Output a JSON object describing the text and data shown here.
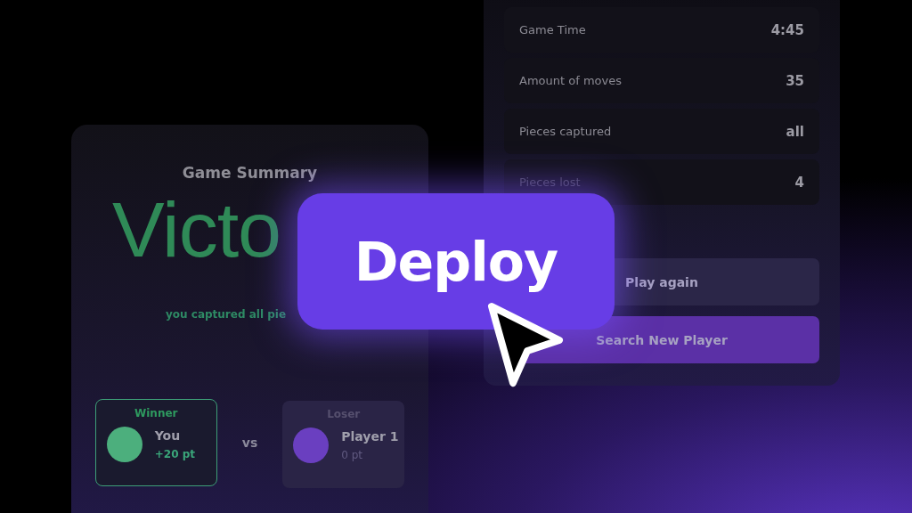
{
  "summary": {
    "title": "Game Summary",
    "result": "Victo",
    "subtitle": "you captured all pie",
    "versus": "vs",
    "players": [
      {
        "kind": "winner",
        "role": "Winner",
        "name": "You",
        "points": "+20 pt",
        "color": "#4caf7d"
      },
      {
        "kind": "loser",
        "role": "Loser",
        "name": "Player 1",
        "points": "0 pt",
        "color": "#6a3fc0"
      }
    ]
  },
  "stats": [
    {
      "label": "Game Time",
      "value": "4:45"
    },
    {
      "label": "Amount of moves",
      "value": "35"
    },
    {
      "label": "Pieces captured",
      "value": "all"
    },
    {
      "label": "Pieces lost",
      "value": "4"
    }
  ],
  "actions": [
    {
      "kind": "secondary",
      "label": "Play again"
    },
    {
      "kind": "primary",
      "label": "Search New Player"
    }
  ],
  "deploy_button": {
    "label": "Deploy"
  }
}
